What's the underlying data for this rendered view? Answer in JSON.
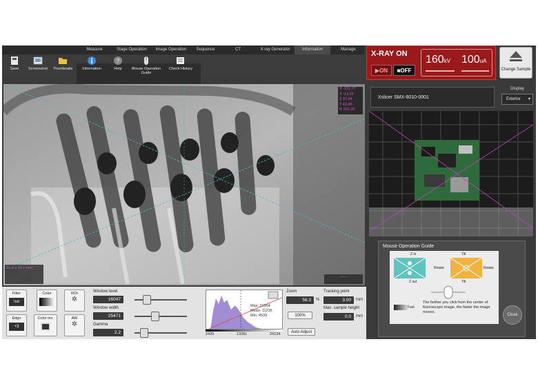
{
  "menu": {
    "tabs": [
      "Measure",
      "Stage Operation",
      "Image Operation",
      "Sequence",
      "CT",
      "X-ray Generator",
      "Information",
      "Manage"
    ],
    "active_tab": "Information"
  },
  "toolbar": {
    "save": "Save",
    "screenshot": "Screenshot",
    "thumbnails": "Thumbnails",
    "information": "Information",
    "help": "Help",
    "mouse_guide": "Mouse Operation Guide",
    "check_history": "Check History"
  },
  "xray": {
    "title": "X-RAY ON",
    "on_label": "▶ON",
    "off_label": "■OFF",
    "kv_value": "160",
    "kv_unit": "kV",
    "ua_value": "100",
    "ua_unit": "uA",
    "change_sample": "Change Sample"
  },
  "viewer": {
    "coords": [
      "X  -101.77",
      "Y  -13.26",
      "Z  37.64",
      "T  42.45",
      "R  102.26"
    ],
    "info_lines": [
      "21.2 x 14.1 mm",
      "",
      ""
    ],
    "scale_label": "——"
  },
  "controls": {
    "filter_label": "Filter",
    "filter_value": "Ind",
    "color_label": "Color",
    "roi_label": "ROI",
    "edge_label": "Edge",
    "edge_value": "+3",
    "color_inv_label": "Color inv.",
    "aw_label": "AW",
    "window_level_label": "Window level",
    "window_level_value": "16047",
    "window_width_label": "Window width",
    "window_width_value": "25471",
    "gamma_label": "Gamma",
    "gamma_value": "2.2",
    "hist_stats": [
      "Max:  21964",
      "Mean: 11236",
      "Min:  4539"
    ],
    "hist_axis": [
      "2429",
      "13281",
      "24134"
    ],
    "zoom_label": "Zoom",
    "zoom_value": "56.3",
    "zoom_unit": "%",
    "zoom_100": "100%",
    "auto_adjust": "Auto Adjust",
    "tracking_label": "Tracking point",
    "tracking_value": "3.00",
    "tracking_unit": "mm",
    "max_height_label": "Max. sample height",
    "max_height_value": "0.0",
    "max_height_unit": "mm"
  },
  "right": {
    "device_name": "Xslicer SMX-6010-0001",
    "display_label": "Display",
    "display_value": "Exterior"
  },
  "guide": {
    "title": "Mouse Operation Guide",
    "zoom_in": "Z in",
    "zoom_out": "Z out",
    "tilt_top": "Tilt",
    "tilt_bottom": "Tilt",
    "rotate_left": "Rotate",
    "rotate_right": "Rotate",
    "note": "The farther you click from the center of fluoroscopic image, the faster the image moves.",
    "fast_label": "Fast",
    "close": "Close"
  },
  "colors": {
    "xray_red": "#9a1a1c",
    "accent_magenta": "#c030c0",
    "guide_teal": "#5fc4c0",
    "guide_orange": "#f0b240"
  }
}
